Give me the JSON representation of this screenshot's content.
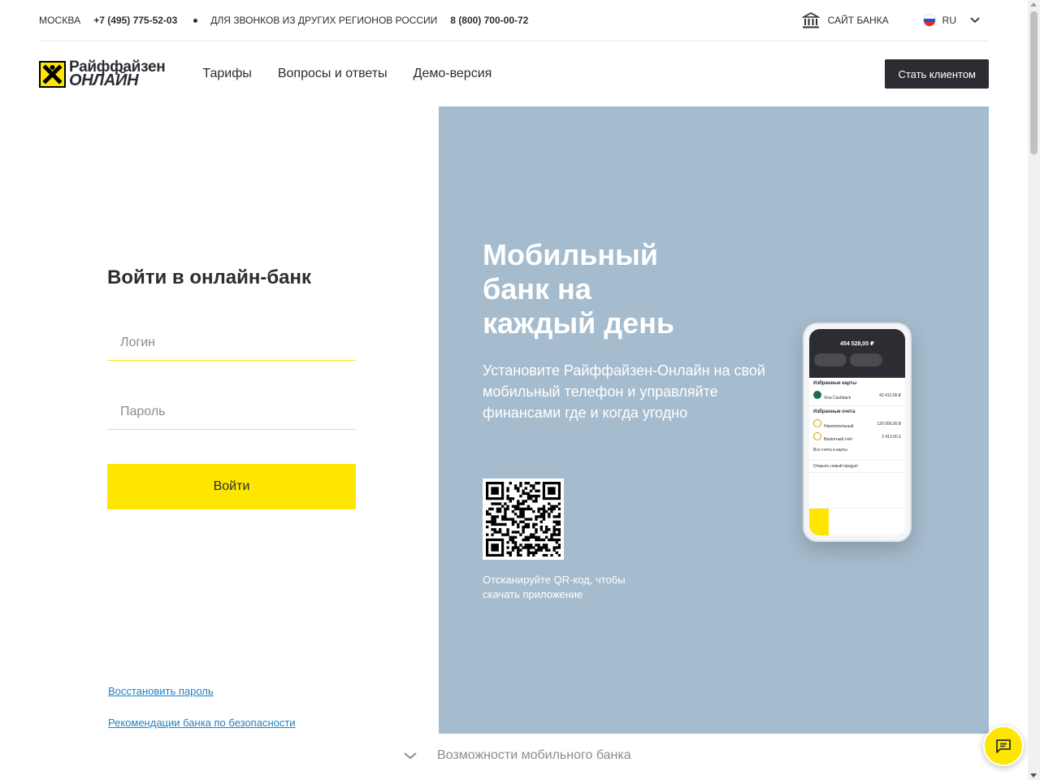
{
  "topbar": {
    "city": "МОСКВА",
    "phone": "+7 (495) 775-52-03",
    "regions_label": "ДЛЯ ЗВОНКОВ ИЗ ДРУГИХ РЕГИОНОВ РОССИИ",
    "phone_regions": "8 (800) 700-00-72",
    "bank_site": "САЙТ БАНКА",
    "lang": "RU"
  },
  "header": {
    "logo_line1": "Райффайзен",
    "logo_line2": "ОНЛАЙН",
    "nav": [
      "Тарифы",
      "Вопросы и ответы",
      "Демо-версия"
    ],
    "cta": "Стать клиентом"
  },
  "login": {
    "title": "Войти в онлайн-банк",
    "login_placeholder": "Логин",
    "password_placeholder": "Пароль",
    "submit": "Войти"
  },
  "links": {
    "restore": "Восстановить пароль",
    "security": "Рекомендации банка по безопасности"
  },
  "promo": {
    "title": "Мобильный банк на каждый день",
    "description": "Установите Райффайзен-Онлайн на свой мобильный телефон и управляйте финансами где и когда угодно",
    "qr_caption": "Отсканируйте QR-код, чтобы скачать приложение",
    "phone_screen": {
      "balance": "454 528,00 ₽",
      "section_cards": "Избранные карты",
      "card_name": "Visa Cashback",
      "card_amount": "42 412,00 ₽",
      "section_accounts": "Избранные счета",
      "acc1_name": "Накопительный",
      "acc1_amount": "120 000,00 ₽",
      "acc2_name": "Валютный счёт",
      "acc2_amount": "2 412,00 £",
      "all_accounts": "Все счета и карты",
      "open_product": "Открыть новый продукт"
    }
  },
  "bottom": {
    "more_label": "Возможности мобильного банка"
  },
  "colors": {
    "brand_yellow": "#fee600",
    "promo_bg": "#a5bcce",
    "dark": "#2b2d33",
    "link": "#1f81c4"
  }
}
